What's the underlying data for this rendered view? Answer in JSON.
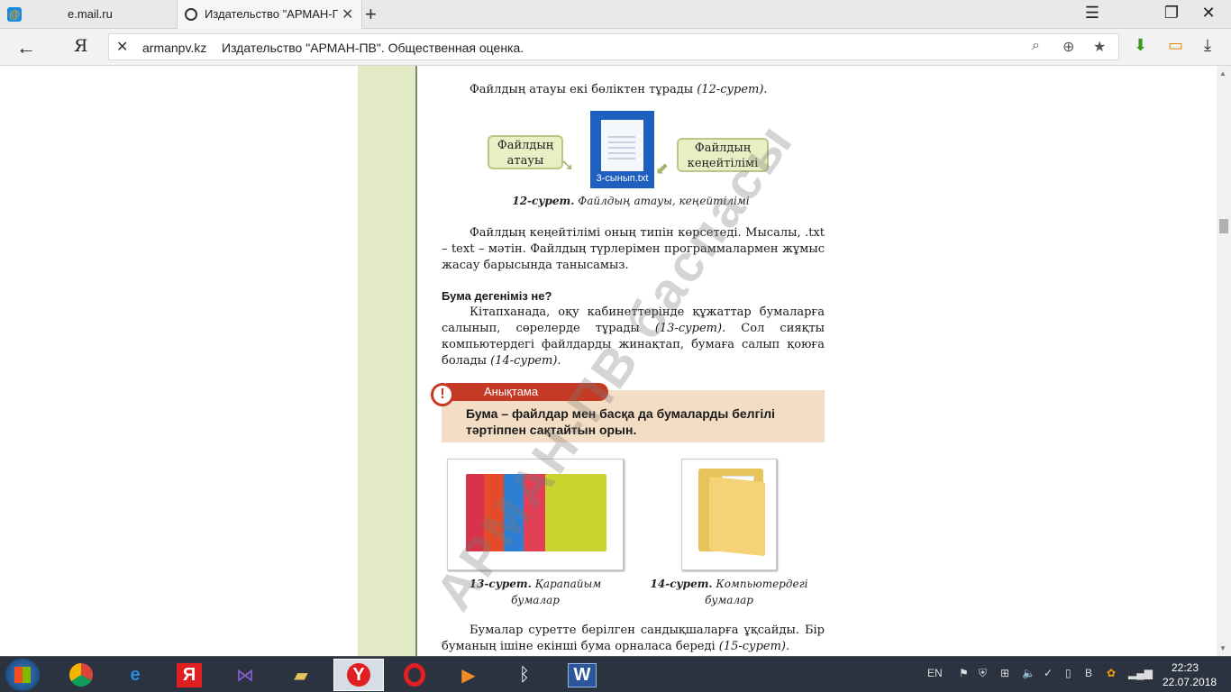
{
  "browser": {
    "tabs": [
      {
        "title": "e.mail.ru",
        "icon": "mail-ru-icon",
        "active": false
      },
      {
        "title": "Издательство \"АРМАН-ПВ\"",
        "icon": "loading-ring-icon",
        "active": true
      }
    ],
    "address": {
      "domain": "armanpv.kz",
      "page_title": "Издательство \"АРМАН-ПВ\". Общественная оценка."
    }
  },
  "page": {
    "intro": "Файлдың атауы екі бөліктен тұрады ",
    "intro_ref": "(12-сурет).",
    "bubble_left": "Файлдың\nатауы",
    "bubble_right": "Файлдың\nкеңейтілімі",
    "file_name": "3-сынып.txt",
    "fig12_label": "12-сурет.",
    "fig12_text": " Файлдың атауы, кеңейтілімі",
    "para1": "Файлдың кеңейтілімі оның типін көрсетеді. Мысалы, .txt – text – мәтін. Файлдың түрлерімен программалармен жұмыс жасау барысында танысамыз.",
    "heading": "Бума дегеніміз не?",
    "para2_a": "Кітапханада, оқу кабинеттерінде құжаттар бумаларға салынып, сөрелерде тұрады ",
    "para2_ref1": "(13-сурет)",
    "para2_b": ". Сол сияқты компьютердегі файлдарды жинақтап, бумаға салып қоюға болады ",
    "para2_ref2": "(14-сурет)",
    "para2_c": ".",
    "note_title": "Анықтама",
    "note_text": "Бума – файлдар мен басқа да бумаларды белгілі тәртіппен сақтайтын орын.",
    "fig13_label": "13-сурет.",
    "fig13_text": " Қарапайым бумалар",
    "fig14_label": "14-сурет.",
    "fig14_text": " Компьютердегі бумалар",
    "para3_a": "Бумалар суретте берілген сандықшаларға ұқсайды. Бір буманың ішіне екінші бума орналаса береді ",
    "para3_ref": "(15-сурет).",
    "watermark": "АРМАН-ПВ баспасы"
  },
  "taskbar": {
    "apps": [
      "ie-icon",
      "chrome-icon",
      "ie-icon",
      "yandex-icon",
      "visual-studio-icon",
      "explorer-icon",
      "yandex-browser-icon",
      "opera-icon",
      "video-icon",
      "bluetooth-icon",
      "word-icon"
    ],
    "lang": "EN",
    "time": "22:23",
    "date": "22.07.2018"
  },
  "colors": {
    "accent_red": "#c53a25",
    "bubble_green": "#e8efc5",
    "page_green": "#e2ebc6",
    "file_blue": "#1f5fc0"
  }
}
